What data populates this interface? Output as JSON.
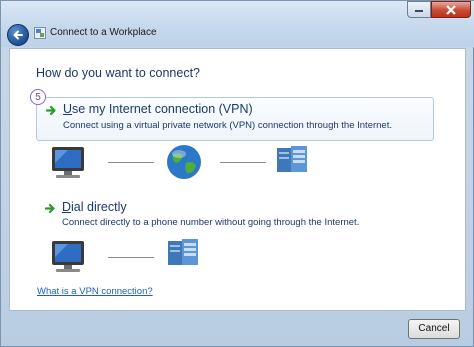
{
  "window": {
    "title": "Connect to a Workplace"
  },
  "heading": "How do you want to connect?",
  "step_badge": "5",
  "options": [
    {
      "title_first": "U",
      "title_rest": "se my Internet connection (VPN)",
      "description": "Connect using a virtual private network (VPN) connection through the Internet."
    },
    {
      "title_first": "D",
      "title_rest": "ial directly",
      "description": "Connect directly to a phone number without going through the Internet."
    }
  ],
  "help_link": "What is a VPN connection?",
  "footer": {
    "cancel_label": "Cancel"
  },
  "icons": {
    "back": "back-arrow-icon",
    "title": "network-icon",
    "option_arrow": "green-arrow-icon",
    "computer": "computer-icon",
    "globe": "globe-icon",
    "server": "server-icon"
  },
  "colors": {
    "text_blue": "#1a3a6b",
    "link": "#1f5fbf",
    "arrow_green": "#2e9a2e",
    "close_red": "#c94a35"
  }
}
